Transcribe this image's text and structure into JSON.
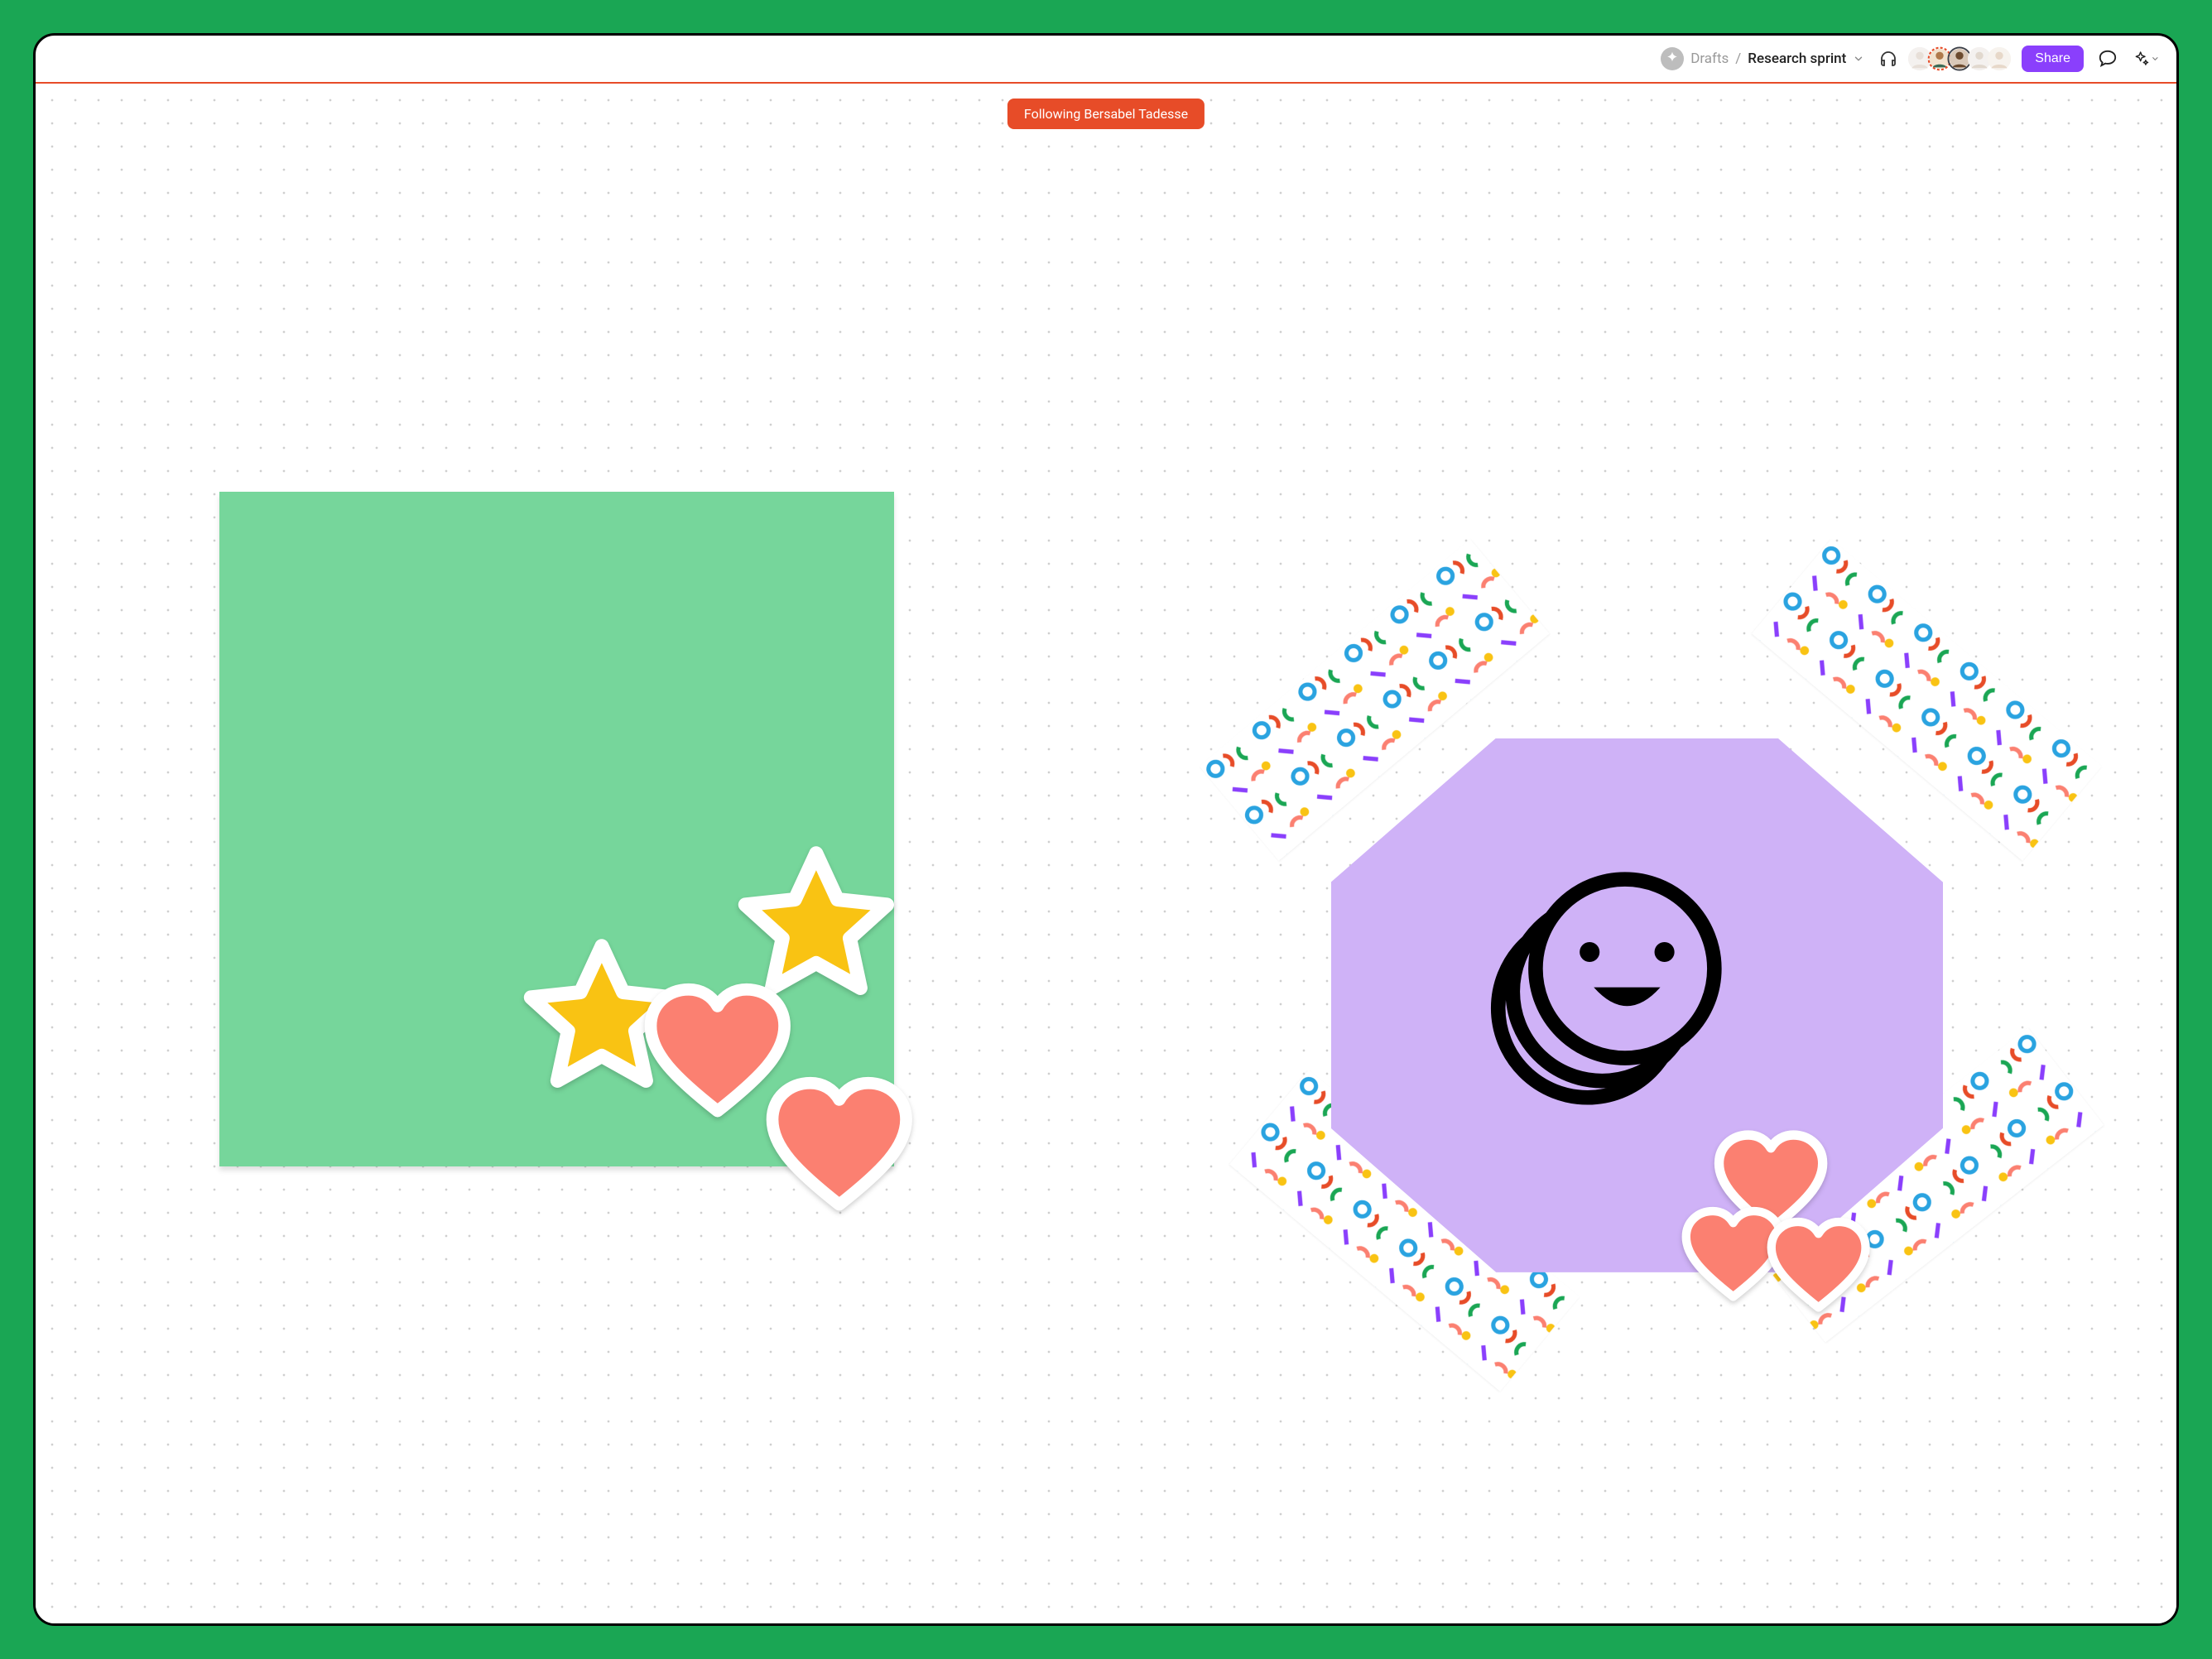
{
  "breadcrumb": {
    "folder": "Drafts",
    "separator": "/",
    "document": "Research sprint"
  },
  "collaborators": [
    {
      "name": "User 1",
      "faded": true
    },
    {
      "name": "Bersabel Tadesse",
      "accent": "dashed-red"
    },
    {
      "name": "User 3",
      "accent": "solid-accent"
    },
    {
      "name": "User 4",
      "faded": true
    },
    {
      "name": "User 5",
      "faded": true
    }
  ],
  "share_label": "Share",
  "follow_chip": "Following Bersabel Tadesse",
  "canvas": {
    "sticky_green": {
      "type": "sticky-note",
      "color": "#76d69b"
    },
    "octagon": {
      "type": "shape",
      "shape": "octagon",
      "color": "#cfb2f7"
    },
    "stickers": {
      "stars": [
        {
          "id": "s1",
          "color": "#f9c313"
        },
        {
          "id": "s2",
          "color": "#f9c313"
        }
      ],
      "hearts": [
        {
          "id": "h1",
          "color": "#fb8071"
        },
        {
          "id": "h2",
          "color": "#fb8071"
        },
        {
          "id": "h3",
          "color": "#fb8071"
        },
        {
          "id": "h4",
          "color": "#fb8071"
        },
        {
          "id": "h5",
          "color": "#fb8071"
        }
      ],
      "tape": [
        {
          "id": "tl",
          "pattern": "confetti"
        },
        {
          "id": "tr",
          "pattern": "confetti"
        },
        {
          "id": "bl",
          "pattern": "confetti"
        },
        {
          "id": "br",
          "pattern": "confetti"
        }
      ],
      "face": {
        "type": "smiley-stack"
      }
    }
  },
  "colors": {
    "page_bg": "#1aa654",
    "accent": "#e74c28",
    "share": "#8a3ffc",
    "sticky_green": "#76d69b",
    "octagon": "#cfb2f7",
    "star_fill": "#f9c313",
    "heart_fill": "#fb8071"
  }
}
